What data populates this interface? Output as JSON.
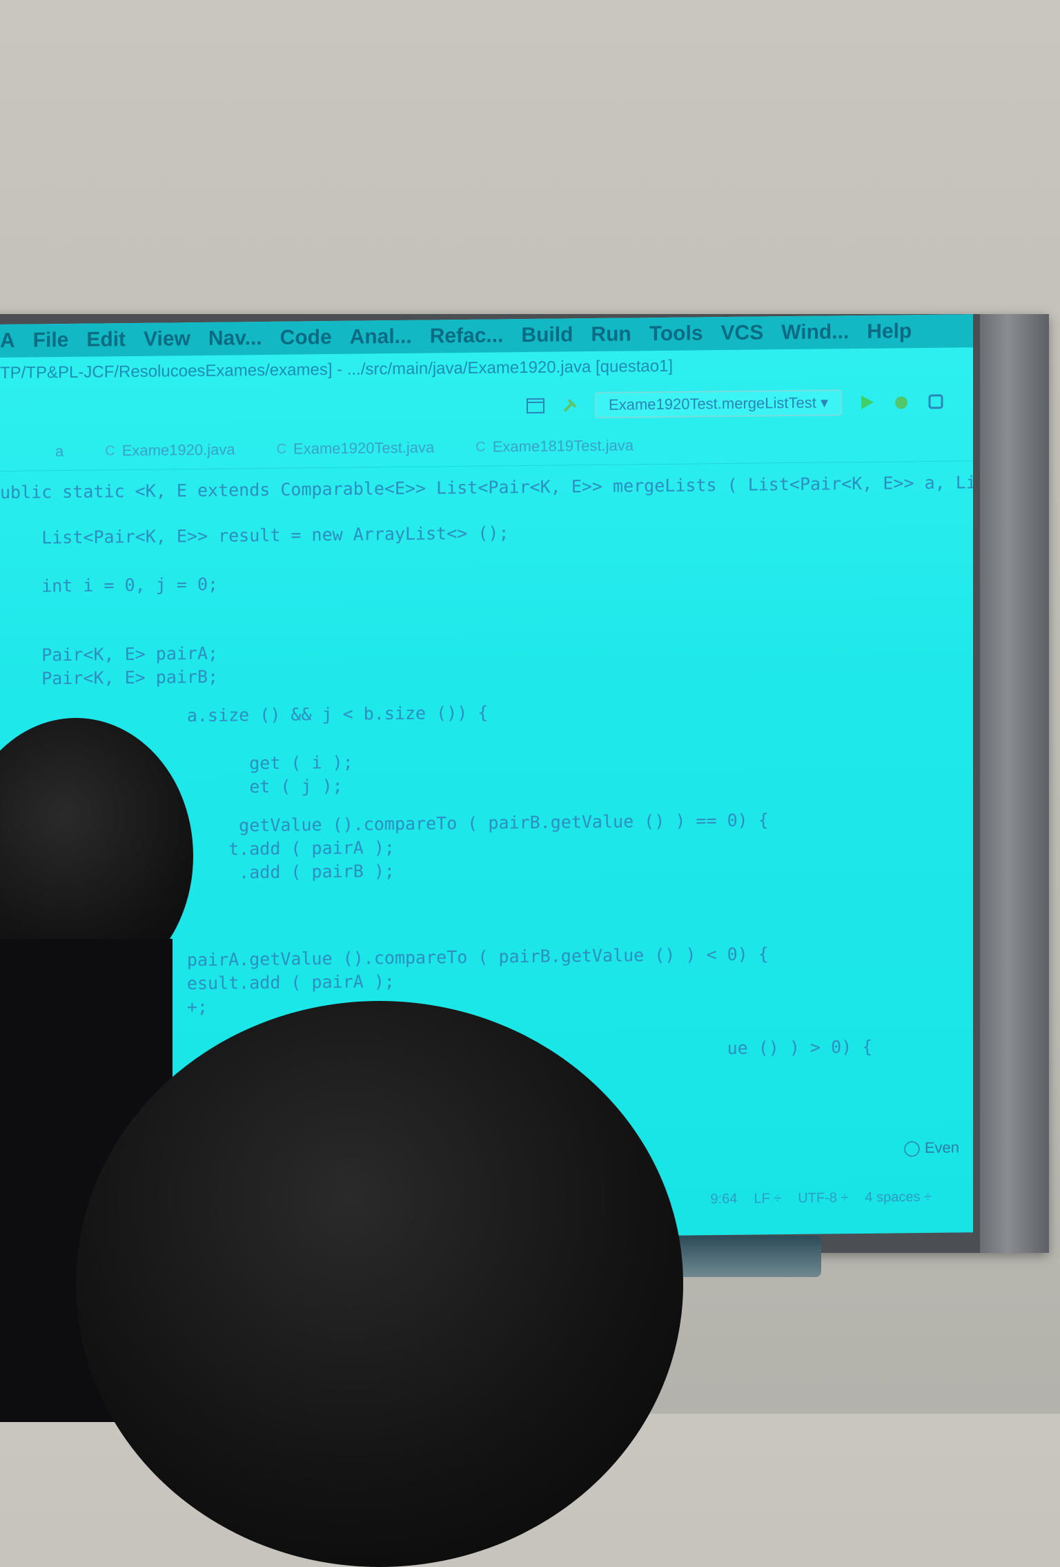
{
  "menu": [
    "A",
    "File",
    "Edit",
    "View",
    "Nav...",
    "Code",
    "Anal...",
    "Refac...",
    "Build",
    "Run",
    "Tools",
    "VCS",
    "Wind...",
    "Help"
  ],
  "title_path": "TP/TP&PL-JCF/ResolucoesExames/exames] - .../src/main/java/Exame1920.java [questao1]",
  "toolbar": {
    "run_config": "Exame1920Test.mergeListTest ▾"
  },
  "tabs": [
    "a",
    "Exame1920.java",
    "Exame1920Test.java",
    "Exame1819Test.java"
  ],
  "code_lines": [
    "ublic static <K, E extends Comparable<E>> List<Pair<K, E>> mergeLists ( List<Pair<K, E>> a, List<P",
    "    List<Pair<K, E>> result = new ArrayList<> ();",
    "    int i = 0, j = 0;",
    "",
    "    Pair<K, E> pairA;",
    "    Pair<K, E> pairB;",
    "                  a.size () && j < b.size ()) {",
    "                        get ( i );",
    "                        et ( j );",
    "                       getValue ().compareTo ( pairB.getValue () ) == 0) {",
    "                      t.add ( pairA );",
    "                       .add ( pairB );",
    "                  pairA.getValue ().compareTo ( pairB.getValue () ) < 0) {",
    "                  esult.add ( pairA );",
    "                  +;",
    "                                                                      ue () ) > 0) {"
  ],
  "status": {
    "position": "9:64",
    "line_sep": "LF ÷",
    "encoding": "UTF-8 ÷",
    "indent": "4 spaces ÷"
  },
  "events_label": "Even"
}
